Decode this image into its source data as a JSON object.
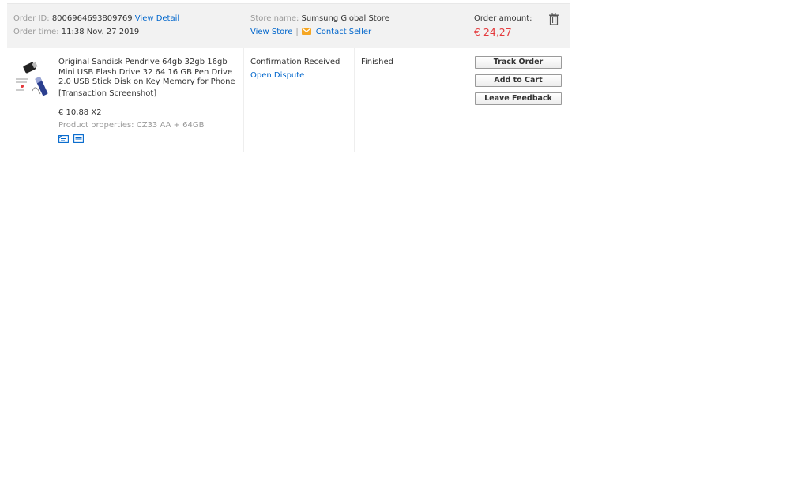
{
  "header": {
    "order_id_label": "Order ID:",
    "order_id_value": "8006964693809769",
    "view_detail": "View Detail",
    "order_time_label": "Order time:",
    "order_time_value": "11:38 Nov. 27 2019",
    "store_name_label": "Store name:",
    "store_name_value": "Sumsung Global Store",
    "view_store": "View Store",
    "separator": "|",
    "contact_seller": "Contact Seller",
    "order_amount_label": "Order amount:",
    "order_amount_value": "€ 24,27"
  },
  "item": {
    "title": "Original Sandisk Pendrive 64gb 32gb 16gb Mini USB Flash Drive 32 64 16 GB Pen Drive 2.0 USB Stick Disk on Key Memory for Phone",
    "transaction_screenshot": "[Transaction Screenshot]",
    "price": "€ 10,88 X2",
    "properties_label": "Product properties:",
    "properties_value": "CZ33 AA + 64GB",
    "status": "Confirmation Received",
    "open_dispute": "Open Dispute",
    "order_status": "Finished"
  },
  "actions": {
    "track_order": "Track Order",
    "add_to_cart": "Add to Cart",
    "leave_feedback": "Leave Feedback"
  },
  "icons": {
    "trash": "trash-icon",
    "mail": "envelope-icon",
    "snapshot": "snapshot-icon",
    "invoice": "invoice-icon"
  },
  "colors": {
    "link": "#0066cc",
    "amount": "#e4393c",
    "mail": "#f5a623",
    "header_bg": "#f2f2f2"
  }
}
